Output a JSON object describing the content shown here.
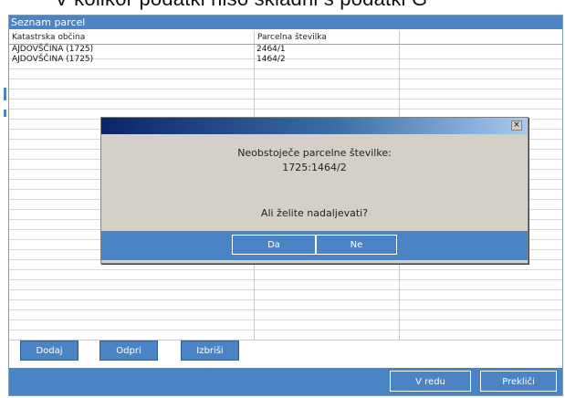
{
  "slide": {
    "partial_text": "V kolikor podatki niso skladni s podatki G"
  },
  "window": {
    "title": "Seznam parcel"
  },
  "table": {
    "columns": [
      "Katastrska občina",
      "Parcelna številka",
      ""
    ],
    "rows": [
      [
        "AJDOVŠČINA (1725)",
        "2464/1",
        ""
      ],
      [
        "AJDOVŠČINA (1725)",
        "1464/2",
        ""
      ]
    ]
  },
  "actions": {
    "add_label": "Dodaj",
    "open_label": "Odpri",
    "delete_label": "Izbriši"
  },
  "footer": {
    "ok_label": "V redu",
    "cancel_label": "Prekliči"
  },
  "dialog": {
    "close_glyph": "×",
    "message_line1": "Neobstoječe parcelne številke:",
    "message_line2": "1725:1464/2",
    "question": "Ali želite nadaljevati?",
    "yes_label": "Da",
    "no_label": "Ne"
  },
  "colors": {
    "accent": "#4a84c4",
    "dialog_bg": "#d4d0c8",
    "title_gradient_start": "#0a246a"
  }
}
